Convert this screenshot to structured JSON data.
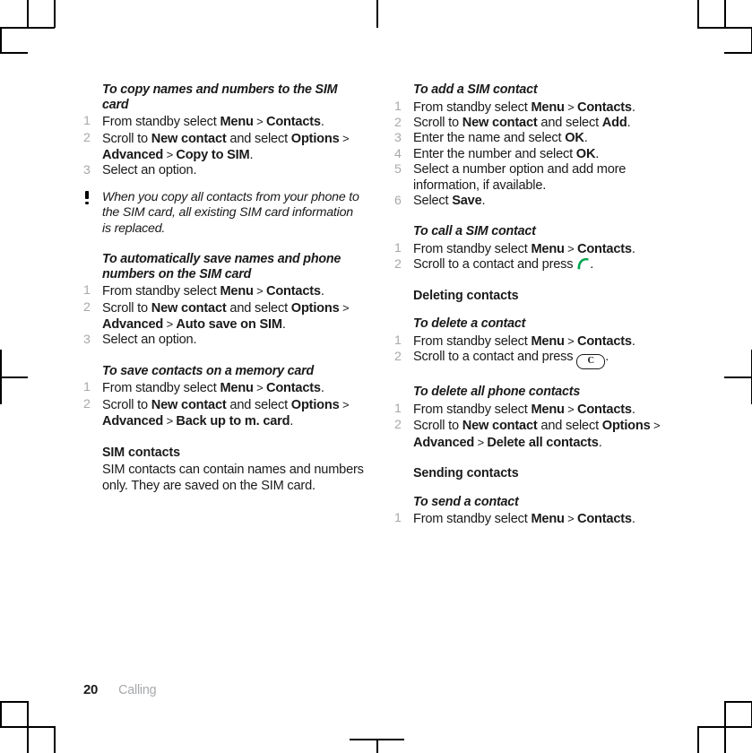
{
  "document": {
    "footer": {
      "page_number": "20",
      "chapter": "Calling"
    }
  },
  "left_column": {
    "s1": {
      "heading": "To copy names and numbers to the SIM card",
      "steps": [
        {
          "pre": "From standby select ",
          "b1": "Menu",
          "mid": " > ",
          "b2": "Contacts",
          "post": "."
        },
        {
          "pre": "Scroll to ",
          "b1": "New contact",
          "mid": " and select ",
          "b2": "Options",
          "gt1": " > ",
          "b3": "Advanced",
          "gt2": " > ",
          "b4": "Copy to SIM",
          "post": "."
        },
        {
          "plain": "Select an option."
        }
      ]
    },
    "note": "When you copy all contacts from your phone to the SIM card, all existing SIM card information is replaced.",
    "s2": {
      "heading": "To automatically save names and phone numbers on the SIM card",
      "steps": [
        {
          "pre": "From standby select ",
          "b1": "Menu",
          "mid": " > ",
          "b2": "Contacts",
          "post": "."
        },
        {
          "pre": "Scroll to ",
          "b1": "New contact",
          "mid": " and select ",
          "b2": "Options",
          "gt1": " > ",
          "b3": "Advanced",
          "gt2": " > ",
          "b4": "Auto save on SIM",
          "post": "."
        },
        {
          "plain": "Select an option."
        }
      ]
    },
    "s3": {
      "heading": "To save contacts on a memory card",
      "steps": [
        {
          "pre": "From standby select ",
          "b1": "Menu",
          "mid": " > ",
          "b2": "Contacts",
          "post": "."
        },
        {
          "pre": "Scroll to ",
          "b1": "New contact",
          "mid": " and select ",
          "b2": "Options",
          "gt1": " > ",
          "b3": "Advanced",
          "gt2": " > ",
          "b4": "Back up to m. card",
          "post": "."
        }
      ]
    },
    "s4": {
      "heading": "SIM contacts",
      "body": "SIM contacts can contain names and numbers only. They are saved on the SIM card."
    }
  },
  "right_column": {
    "s1": {
      "heading": "To add a SIM contact",
      "steps": [
        {
          "pre": "From standby select ",
          "b1": "Menu",
          "mid": " > ",
          "b2": "Contacts",
          "post": "."
        },
        {
          "pre": "Scroll to ",
          "b1": "New contact",
          "mid": " and select ",
          "b2": "Add",
          "post": "."
        },
        {
          "pre": "Enter the name and select ",
          "b1": "OK",
          "post": "."
        },
        {
          "pre": "Enter the number and select ",
          "b1": "OK",
          "post": "."
        },
        {
          "plain": "Select a number option and add more information, if available."
        },
        {
          "pre": "Select ",
          "b1": "Save",
          "post": "."
        }
      ]
    },
    "s2": {
      "heading": "To call a SIM contact",
      "steps": [
        {
          "pre": "From standby select ",
          "b1": "Menu",
          "mid": " > ",
          "b2": "Contacts",
          "post": "."
        },
        {
          "pre": "Scroll to a contact and press ",
          "icon": "call-key-icon",
          "post": "."
        }
      ]
    },
    "s3": {
      "heading": "Deleting contacts"
    },
    "s4": {
      "heading": "To delete a contact",
      "steps": [
        {
          "pre": "From standby select ",
          "b1": "Menu",
          "mid": " > ",
          "b2": "Contacts",
          "post": "."
        },
        {
          "pre": "Scroll to a contact and press ",
          "icon": "clear-key-icon",
          "icon_label": "C",
          "post": "."
        }
      ]
    },
    "s5": {
      "heading": "To delete all phone contacts",
      "steps": [
        {
          "pre": "From standby select ",
          "b1": "Menu",
          "mid": " > ",
          "b2": "Contacts",
          "post": "."
        },
        {
          "pre": "Scroll to ",
          "b1": "New contact",
          "mid": " and select ",
          "b2": "Options",
          "gt1": " > ",
          "b3": "Advanced",
          "gt2": " > ",
          "b4": "Delete all contacts",
          "post": "."
        }
      ]
    },
    "s6": {
      "heading": "Sending contacts"
    },
    "s7": {
      "heading": "To send a contact",
      "steps": [
        {
          "pre": "From standby select ",
          "b1": "Menu",
          "mid": " > ",
          "b2": "Contacts",
          "post": "."
        }
      ]
    }
  },
  "colors": {
    "text": "#1a1a1a",
    "muted": "#a6a8ab",
    "call_green": "#00a651"
  }
}
